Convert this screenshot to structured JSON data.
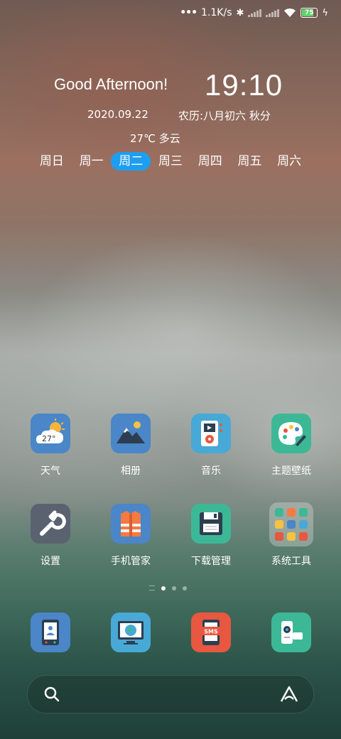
{
  "status_bar": {
    "speed": "1.1K/s",
    "battery": "75"
  },
  "widget": {
    "greeting": "Good Afternoon!",
    "time": "19:10",
    "date": "2020.09.22",
    "lunar": "农历:八月初六 秋分",
    "weather": "27℃  多云",
    "weekdays": [
      "周日",
      "周一",
      "周二",
      "周三",
      "周四",
      "周五",
      "周六"
    ],
    "active_weekday_index": 2
  },
  "apps": [
    {
      "label": "天气",
      "icon": "weather-icon",
      "badge": "27°"
    },
    {
      "label": "相册",
      "icon": "gallery-icon"
    },
    {
      "label": "音乐",
      "icon": "music-icon"
    },
    {
      "label": "主题壁纸",
      "icon": "theme-icon"
    },
    {
      "label": "设置",
      "icon": "settings-icon"
    },
    {
      "label": "手机管家",
      "icon": "security-icon"
    },
    {
      "label": "下载管理",
      "icon": "download-icon"
    },
    {
      "label": "系统工具",
      "icon": "folder-icon"
    }
  ],
  "dock": [
    {
      "icon": "phone-icon"
    },
    {
      "icon": "browser-icon"
    },
    {
      "icon": "messages-icon",
      "text": "SMS"
    },
    {
      "icon": "camera-icon"
    }
  ],
  "page_indicator": {
    "pages": 3,
    "current": 0
  },
  "colors": {
    "accent": "#1e9ef0"
  }
}
